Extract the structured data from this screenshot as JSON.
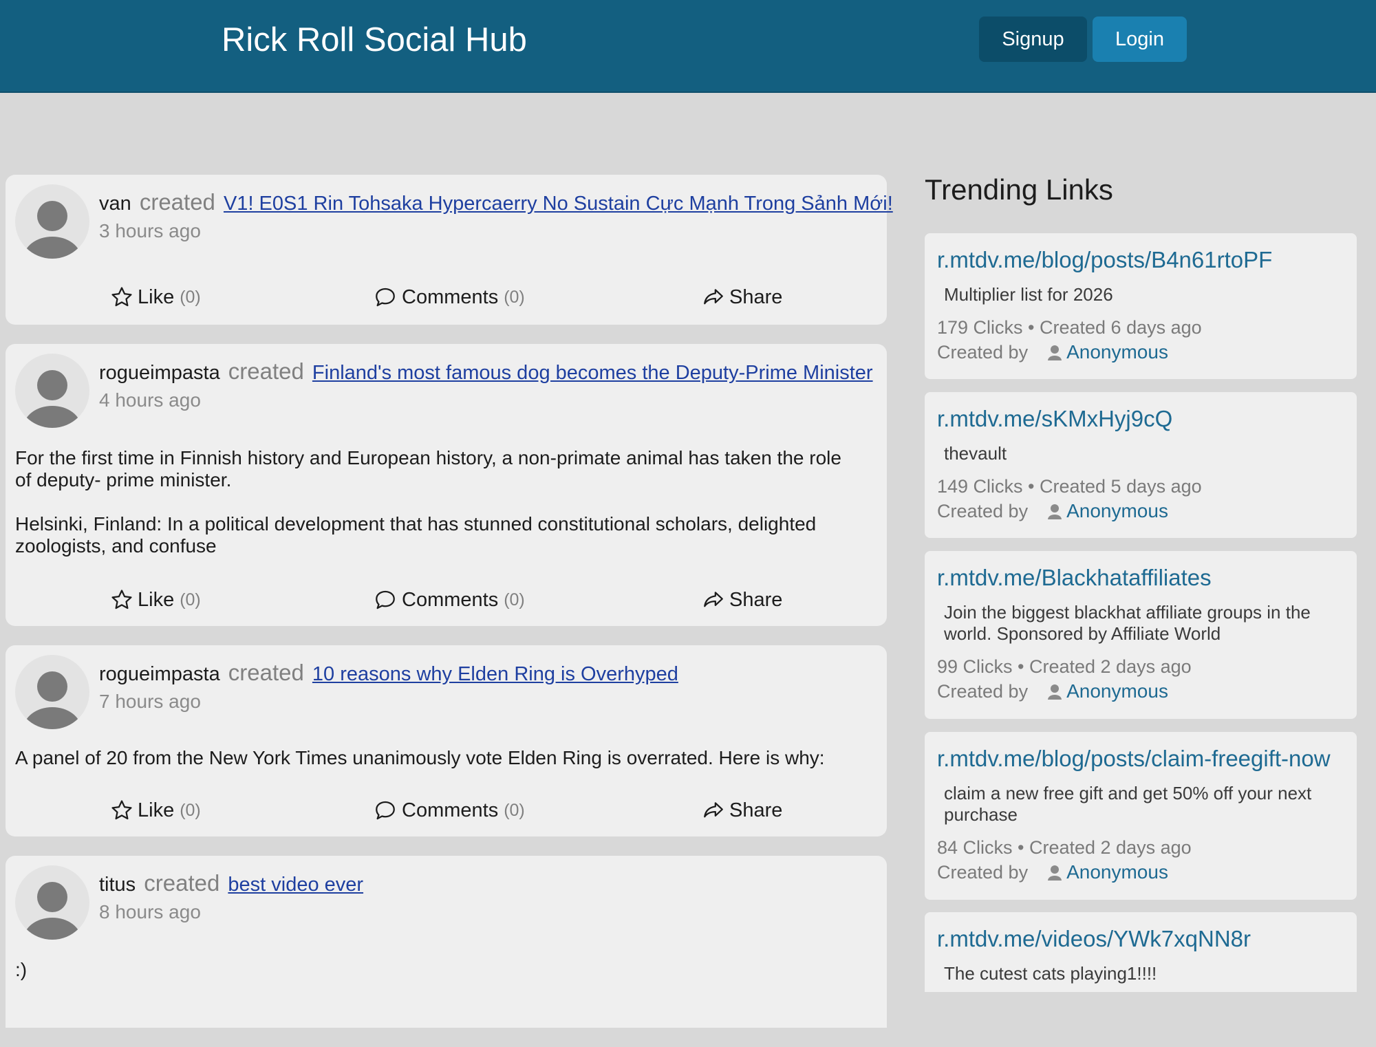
{
  "header": {
    "title": "Rick Roll Social Hub",
    "signup_label": "Signup",
    "login_label": "Login"
  },
  "feed": {
    "posts": [
      {
        "user": "van",
        "verb": "created",
        "link": "V1! E0S1 Rin Tohsaka Hypercaerry No Sustain Cực Mạnh Trong Sảnh Mới!",
        "time": "3 hours ago",
        "body": [],
        "like_label": "Like",
        "like_count": "(0)",
        "comments_label": "Comments",
        "comments_count": "(0)",
        "share_label": "Share"
      },
      {
        "user": "rogueimpasta",
        "verb": "created",
        "link": "Finland's most famous dog becomes the Deputy-Prime Minister",
        "time": "4 hours ago",
        "body": [
          "For the first time in Finnish history and European history, a non-primate animal has taken the role of deputy- prime minister.",
          "Helsinki, Finland: In a political development that has stunned constitutional scholars, delighted zoologists, and confuse"
        ],
        "like_label": "Like",
        "like_count": "(0)",
        "comments_label": "Comments",
        "comments_count": "(0)",
        "share_label": "Share"
      },
      {
        "user": "rogueimpasta",
        "verb": "created",
        "link": "10 reasons why Elden Ring is Overhyped",
        "time": "7 hours ago",
        "body": [
          "A panel of 20 from the New York Times unanimously vote Elden Ring is overrated. Here is why:"
        ],
        "like_label": "Like",
        "like_count": "(0)",
        "comments_label": "Comments",
        "comments_count": "(0)",
        "share_label": "Share"
      },
      {
        "user": "titus",
        "verb": "created",
        "link": "best video ever",
        "time": "8 hours ago",
        "body": [
          ":)"
        ]
      }
    ]
  },
  "sidebar": {
    "title": "Trending Links",
    "created_by_label": "Created by",
    "links": [
      {
        "url": "r.mtdv.me/blog/posts/B4n61rtoPF",
        "desc": "Multiplier list for 2026",
        "meta": "179 Clicks • Created 6 days ago",
        "author": "Anonymous"
      },
      {
        "url": "r.mtdv.me/sKMxHyj9cQ",
        "desc": "thevault",
        "meta": "149 Clicks • Created 5 days ago",
        "author": "Anonymous"
      },
      {
        "url": "r.mtdv.me/Blackhataffiliates",
        "desc": "Join the biggest blackhat affiliate groups in the world. Sponsored by Affiliate World",
        "meta": "99 Clicks • Created 2 days ago",
        "author": "Anonymous"
      },
      {
        "url": "r.mtdv.me/blog/posts/claim-freegift-now",
        "desc": "claim a new free gift and get 50% off your next purchase",
        "meta": "84 Clicks • Created 2 days ago",
        "author": "Anonymous"
      },
      {
        "url": "r.mtdv.me/videos/YWk7xqNN8r",
        "desc": "The cutest cats playing1!!!!"
      }
    ]
  },
  "colors": {
    "header_bg": "#135f80",
    "signup_bg": "#0c4d69",
    "login_bg": "#1a80b0",
    "link": "#1e3fa0",
    "trending_link": "#1e6a92",
    "page_bg": "#d8d8d8",
    "card_bg": "#efefef"
  },
  "icons": {
    "avatar": "default-avatar-icon",
    "like": "star-outline-icon",
    "comments": "speech-bubble-icon",
    "share": "share-arrow-icon",
    "author": "person-icon"
  }
}
